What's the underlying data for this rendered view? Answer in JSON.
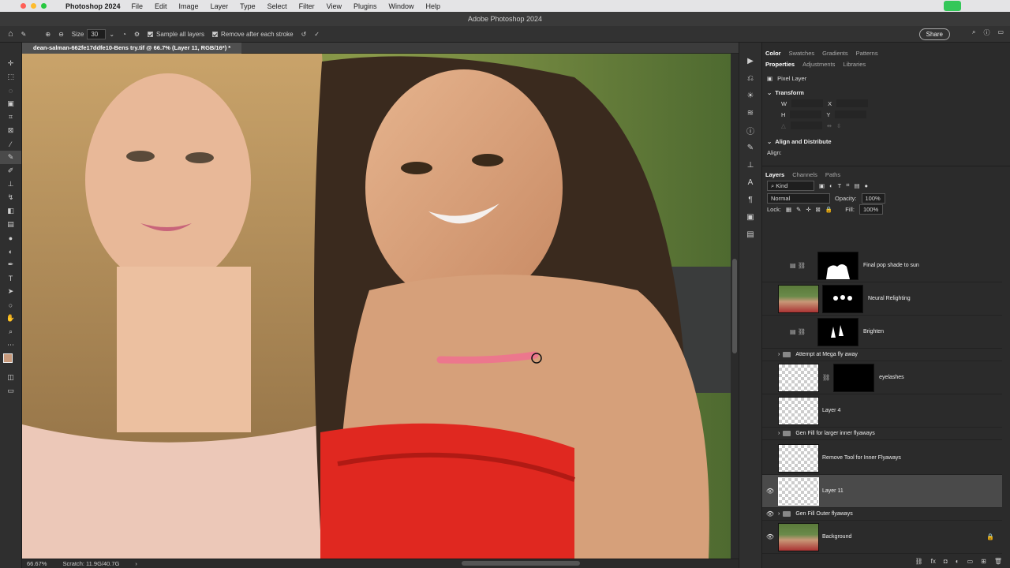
{
  "menubar": {
    "app_name": "Photoshop 2024",
    "items": [
      "File",
      "Edit",
      "Image",
      "Layer",
      "Type",
      "Select",
      "Filter",
      "View",
      "Plugins",
      "Window",
      "Help"
    ]
  },
  "window_title": "Adobe Photoshop 2024",
  "options": {
    "size_label": "Size",
    "size_value": "30",
    "sample_all_layers": "Sample all layers",
    "remove_after_stroke": "Remove after each stroke",
    "share": "Share"
  },
  "document_tab": "dean-salman-662fe17ddfe10-Bens try.tif @ 66.7% (Layer 11, RGB/16*) *",
  "status": {
    "zoom": "66.67%",
    "scratch": "Scratch: 11.9G/40.7G"
  },
  "panel_tabs_top": [
    "Color",
    "Swatches",
    "Gradients",
    "Patterns"
  ],
  "panel_tabs_props": [
    "Properties",
    "Adjustments",
    "Libraries"
  ],
  "properties": {
    "pixel_layer": "Pixel Layer",
    "transform": "Transform",
    "w_label": "W",
    "h_label": "H",
    "x_label": "X",
    "y_label": "Y",
    "align": "Align and Distribute",
    "align_label": "Align:"
  },
  "layers_tabs": [
    "Layers",
    "Channels",
    "Paths"
  ],
  "layers_filter": "Kind",
  "blend_mode": "Normal",
  "opacity_label": "Opacity:",
  "opacity_value": "100%",
  "lock_label": "Lock:",
  "fill_label": "Fill:",
  "fill_value": "100%",
  "layers": {
    "final_pop": "Final pop shade to sun",
    "neural": "Neural Relighting",
    "brighten": "Brighten",
    "mega_group": "Attempt at Mega fly away",
    "eyelashes": "eyelashes",
    "layer4": "Layer 4",
    "gen_fill_inner": "Gen Fill for larger inner flyaways",
    "remove_tool": "Remove Tool for Inner Flyaways",
    "layer11": "Layer 11",
    "gen_fill_outer": "Gen Fill Outer flyaways",
    "background": "Background"
  }
}
